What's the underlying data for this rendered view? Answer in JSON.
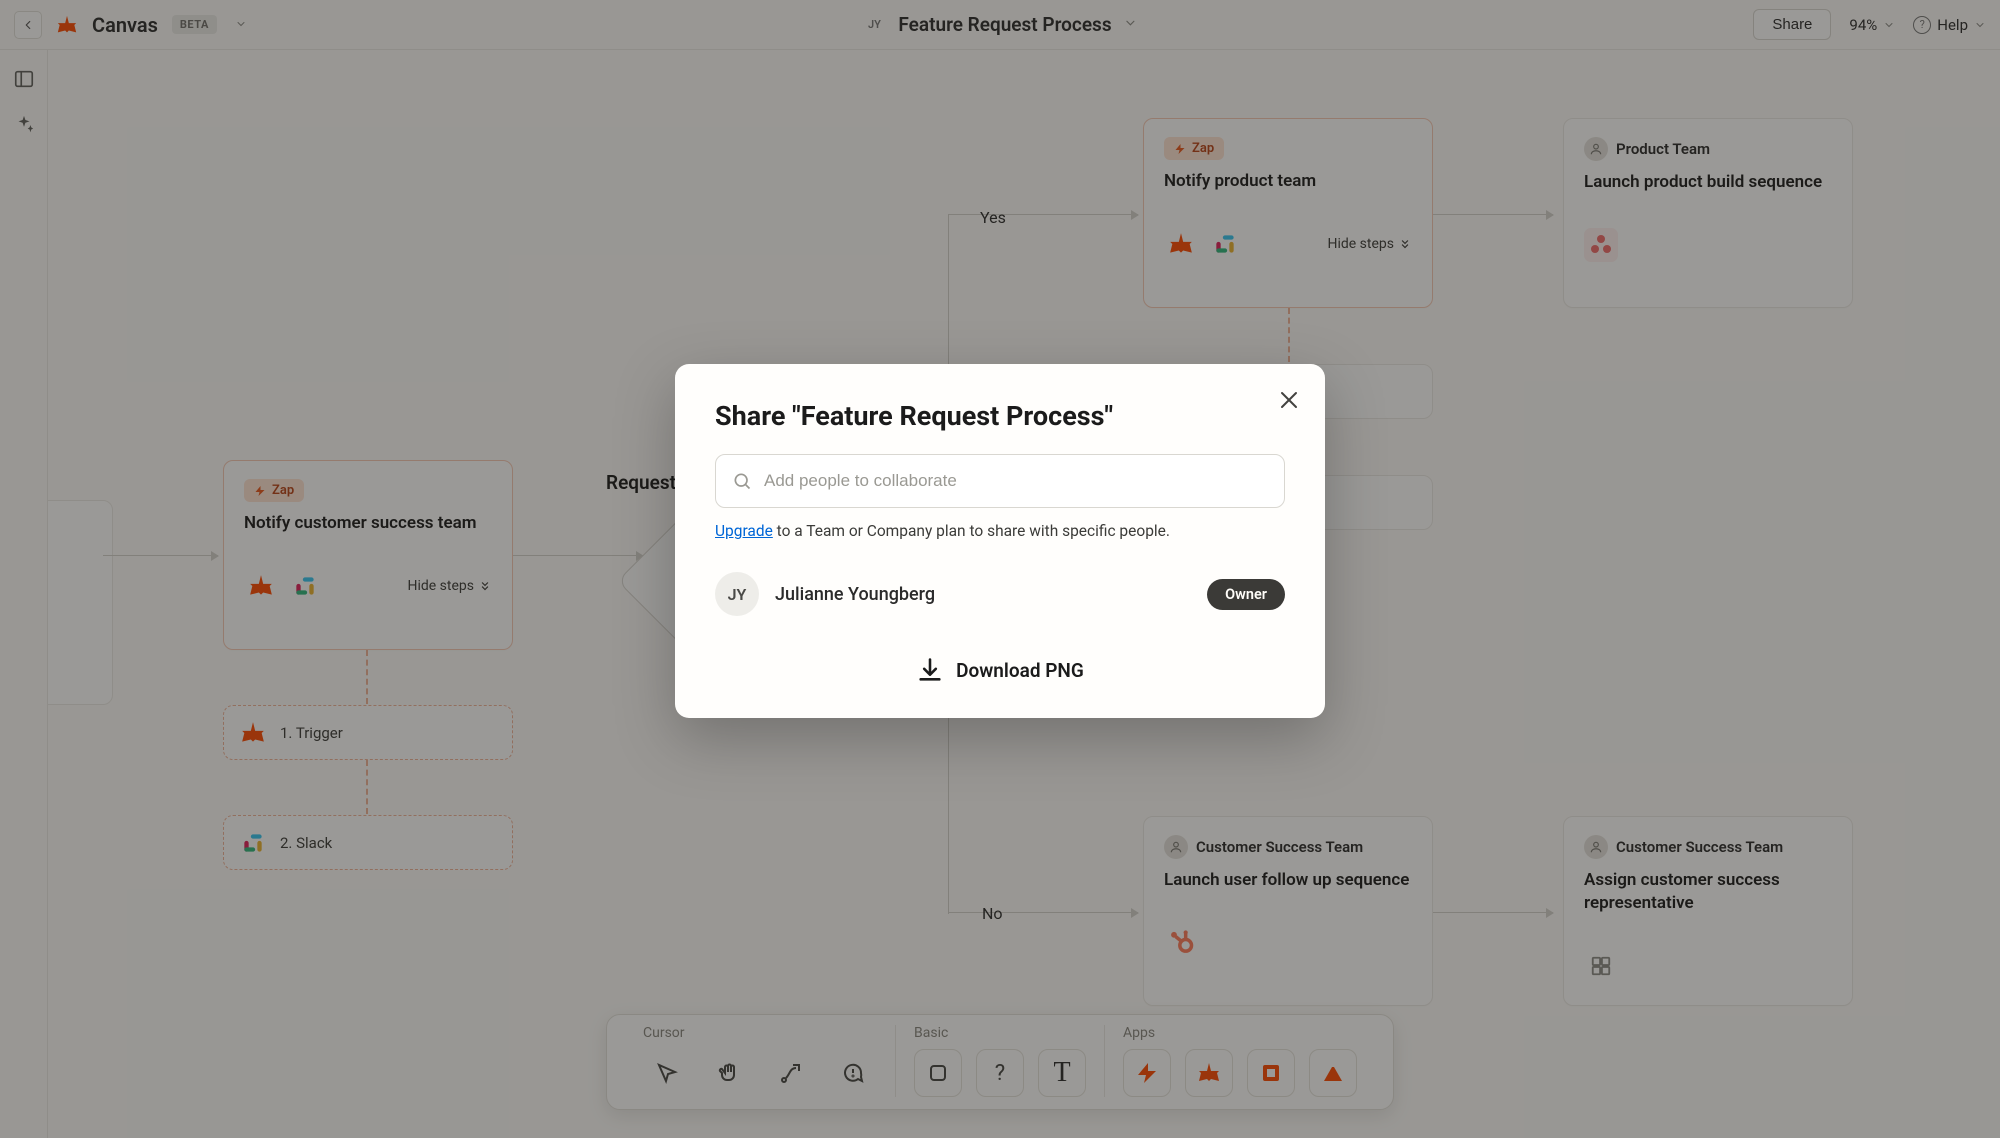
{
  "topbar": {
    "brand": "Canvas",
    "beta": "BETA",
    "user_initials": "JY",
    "doc_title": "Feature Request Process",
    "share": "Share",
    "zoom": "94%",
    "help": "Help"
  },
  "labels": {
    "request_approved": "Request approved?",
    "yes": "Yes",
    "no": "No"
  },
  "cards": {
    "notify_cs": {
      "pill": "Zap",
      "title": "Notify customer success team",
      "hide": "Hide steps"
    },
    "step1": "1. Trigger",
    "step2": "2. Slack",
    "notify_product": {
      "pill": "Zap",
      "title": "Notify product team",
      "hide": "Hide steps"
    },
    "launch_build": {
      "team": "Product Team",
      "title": "Launch product build sequence"
    },
    "launch_followup": {
      "team": "Customer Success Team",
      "title": "Launch user follow up sequence"
    },
    "assign_rep": {
      "team": "Customer Success Team",
      "title": "Assign customer success representative"
    }
  },
  "toolbar": {
    "cursor": "Cursor",
    "basic": "Basic",
    "apps": "Apps",
    "question": "?"
  },
  "modal": {
    "title": "Share \"Feature Request Process\"",
    "placeholder": "Add people to collaborate",
    "upgrade": "Upgrade",
    "hint_rest": " to a Team or Company plan to share with specific people.",
    "member_initials": "JY",
    "member_name": "Julianne Youngberg",
    "owner": "Owner",
    "download": "Download PNG"
  }
}
